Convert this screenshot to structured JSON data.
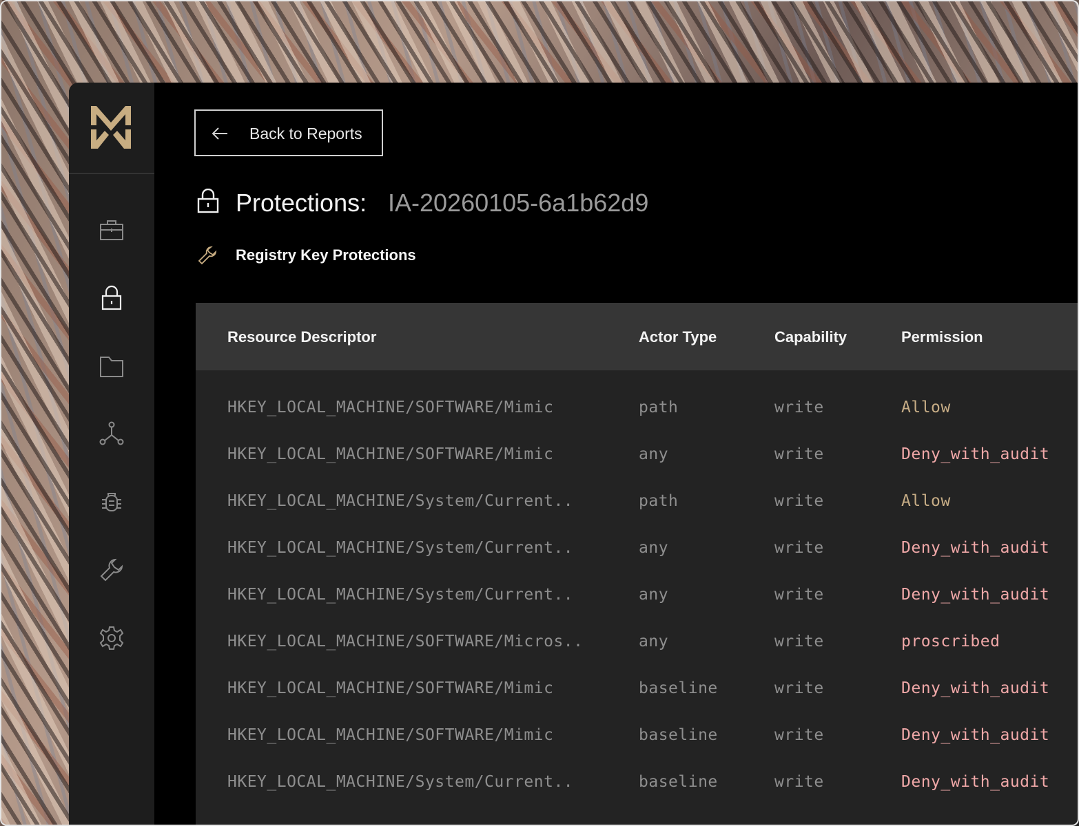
{
  "sidebar": {
    "logo": "brand-logo",
    "items": [
      {
        "name": "briefcase-icon"
      },
      {
        "name": "lock-icon"
      },
      {
        "name": "folder-icon"
      },
      {
        "name": "network-icon"
      },
      {
        "name": "bug-icon"
      },
      {
        "name": "wrench-icon"
      },
      {
        "name": "gear-icon"
      }
    ]
  },
  "header": {
    "back_label": "Back to Reports",
    "title_label": "Protections:",
    "title_id": "IA-20260105-6a1b62d9",
    "subtitle": "Registry Key Protections"
  },
  "table": {
    "columns": [
      "Resource Descriptor",
      "Actor Type",
      "Capability",
      "Permission"
    ],
    "rows": [
      {
        "resource": "HKEY_LOCAL_MACHINE/SOFTWARE/Mimic",
        "actor": "path",
        "capability": "write",
        "permission": "Allow"
      },
      {
        "resource": "HKEY_LOCAL_MACHINE/SOFTWARE/Mimic",
        "actor": "any",
        "capability": "write",
        "permission": "Deny_with_audit"
      },
      {
        "resource": "HKEY_LOCAL_MACHINE/System/Current..",
        "actor": "path",
        "capability": "write",
        "permission": "Allow"
      },
      {
        "resource": "HKEY_LOCAL_MACHINE/System/Current..",
        "actor": "any",
        "capability": "write",
        "permission": "Deny_with_audit"
      },
      {
        "resource": "HKEY_LOCAL_MACHINE/System/Current..",
        "actor": "any",
        "capability": "write",
        "permission": "Deny_with_audit"
      },
      {
        "resource": "HKEY_LOCAL_MACHINE/SOFTWARE/Micros..",
        "actor": "any",
        "capability": "write",
        "permission": "proscribed"
      },
      {
        "resource": "HKEY_LOCAL_MACHINE/SOFTWARE/Mimic",
        "actor": "baseline",
        "capability": "write",
        "permission": "Deny_with_audit"
      },
      {
        "resource": "HKEY_LOCAL_MACHINE/SOFTWARE/Mimic",
        "actor": "baseline",
        "capability": "write",
        "permission": "Deny_with_audit"
      },
      {
        "resource": "HKEY_LOCAL_MACHINE/System/Current..",
        "actor": "baseline",
        "capability": "write",
        "permission": "Deny_with_audit"
      }
    ]
  },
  "colors": {
    "allow": "#c7ad86",
    "deny": "#f0a8a8",
    "accent_logo": "#c8ad82"
  }
}
